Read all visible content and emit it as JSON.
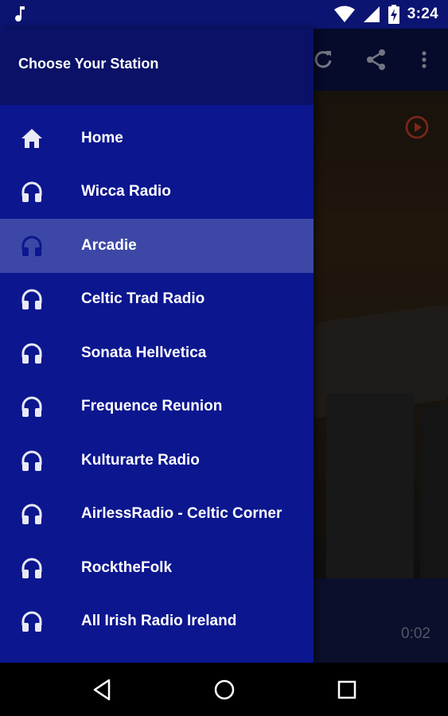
{
  "status_bar": {
    "time": "3:24",
    "icons": [
      "music-note-icon",
      "wifi-icon",
      "signal-icon",
      "battery-charging-icon"
    ]
  },
  "app": {
    "toolbar_icons": [
      "refresh-icon",
      "share-icon",
      "more-vert-icon"
    ],
    "elapsed_time": "0:02"
  },
  "drawer": {
    "title": "Choose Your Station",
    "items": [
      {
        "label": "Home",
        "icon": "home-icon",
        "selected": false
      },
      {
        "label": "Wicca Radio",
        "icon": "headphones-icon",
        "selected": false
      },
      {
        "label": "Arcadie",
        "icon": "headphones-icon",
        "selected": true
      },
      {
        "label": "Celtic Trad Radio",
        "icon": "headphones-icon",
        "selected": false
      },
      {
        "label": "Sonata Hellvetica",
        "icon": "headphones-icon",
        "selected": false
      },
      {
        "label": "Frequence Reunion",
        "icon": "headphones-icon",
        "selected": false
      },
      {
        "label": "Kulturarte Radio",
        "icon": "headphones-icon",
        "selected": false
      },
      {
        "label": "AirlessRadio - Celtic Corner",
        "icon": "headphones-icon",
        "selected": false
      },
      {
        "label": "RocktheFolk",
        "icon": "headphones-icon",
        "selected": false
      },
      {
        "label": "All Irish Radio Ireland",
        "icon": "headphones-icon",
        "selected": false
      }
    ]
  },
  "nav_bar": {
    "buttons": [
      "back-icon",
      "home-circle-icon",
      "recents-icon"
    ]
  },
  "colors": {
    "drawer_bg": "#0c168f",
    "drawer_header_bg": "#0a1167",
    "selected_bg": "#3d48a6",
    "icon_default": "#e8eaf6",
    "icon_selected": "#0c168f",
    "accent": "#d8442b"
  }
}
